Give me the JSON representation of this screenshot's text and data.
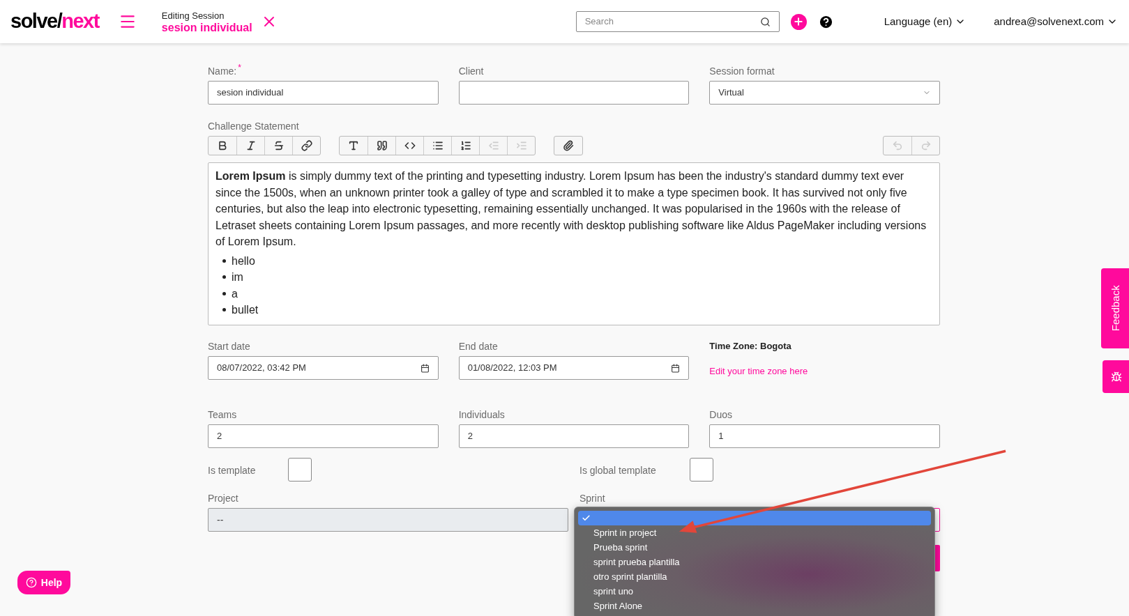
{
  "header": {
    "logo_left": "solve/",
    "logo_right": "next",
    "context_label": "Editing Session",
    "context_title": "sesion individual",
    "search": {
      "placeholder": "Search"
    },
    "language": "Language (en)",
    "user": "andrea@solvenext.com"
  },
  "required_mark": "*",
  "fields_row1": [
    {
      "label": "Name:",
      "required": true,
      "value": "sesion individual",
      "kind": "text"
    },
    {
      "label": "Client",
      "required": false,
      "kind": "text"
    },
    {
      "label": "Session format",
      "required": false,
      "value": "Virtual",
      "kind": "select"
    }
  ],
  "challenge": {
    "label": "Challenge Statement",
    "toolbar": [
      [
        {
          "kind": "bold",
          "disabled": false
        },
        {
          "kind": "italic",
          "disabled": false
        },
        {
          "kind": "strike",
          "disabled": false
        },
        {
          "kind": "link",
          "disabled": false
        }
      ],
      [
        {
          "kind": "heading",
          "disabled": false
        },
        {
          "kind": "quote",
          "disabled": false
        },
        {
          "kind": "code",
          "disabled": false
        },
        {
          "kind": "bullets",
          "disabled": false
        },
        {
          "kind": "numbers",
          "disabled": false
        },
        {
          "kind": "outdent",
          "disabled": true
        },
        {
          "kind": "indent",
          "disabled": true
        }
      ],
      [
        {
          "kind": "attach",
          "disabled": false
        }
      ],
      [
        {
          "kind": "undo",
          "disabled": true
        },
        {
          "kind": "redo",
          "disabled": true
        }
      ]
    ],
    "paragraph": "**Lorem Ipsum** is simply dummy text of the printing and typesetting industry. Lorem Ipsum has been the industry's standard dummy text ever since the 1500s, when an unknown printer took a galley of type and scrambled it to make a type specimen book. It has survived not only five centuries, but also the leap into electronic typesetting, remaining essentially unchanged. It was popularised in the 1960s with the release of Letraset sheets containing Lorem Ipsum passages, and more recently with desktop publishing software like Aldus PageMaker including versions of Lorem Ipsum.",
    "bullets": [
      "hello",
      "im",
      "a",
      "bullet"
    ]
  },
  "start_date": {
    "label": "Start date",
    "value": "08/07/2022, 03:42 PM"
  },
  "end_date": {
    "label": "End date",
    "value": "01/08/2022, 12:03 PM"
  },
  "time_zone": {
    "label": "Time Zone: Bogota",
    "link": "Edit your time zone here"
  },
  "counts": [
    {
      "label": "Teams",
      "value": "2"
    },
    {
      "label": "Individuals",
      "value": "2"
    },
    {
      "label": "Duos",
      "value": "1"
    }
  ],
  "checks": [
    {
      "label": "Is template",
      "checked": false
    },
    {
      "label": "Is global template",
      "checked": false
    }
  ],
  "project": {
    "label": "Project",
    "value": "--"
  },
  "sprint": {
    "label": "Sprint"
  },
  "sprint_options": [
    {
      "selected": true
    },
    {
      "label": "Sprint in project",
      "selected": false
    },
    {
      "label": "Prueba sprint",
      "selected": false
    },
    {
      "label": "sprint prueba plantilla",
      "selected": false
    },
    {
      "label": "otro sprint plantilla",
      "selected": false
    },
    {
      "label": "sprint uno",
      "selected": false
    },
    {
      "label": "Sprint Alone",
      "selected": false
    }
  ],
  "feedback": "Feedback",
  "help": "Help"
}
